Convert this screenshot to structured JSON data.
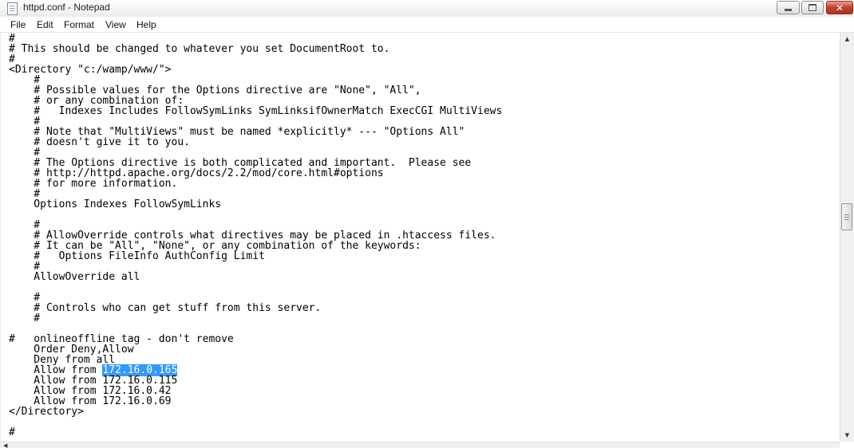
{
  "window": {
    "title": "httpd.conf - Notepad",
    "icon": "notepad-icon",
    "controls": {
      "minimize": "minimize-icon",
      "maximize": "maximize-icon",
      "close": "✕"
    }
  },
  "menu": [
    "File",
    "Edit",
    "Format",
    "View",
    "Help"
  ],
  "editor": {
    "lines": [
      "#",
      "# This should be changed to whatever you set DocumentRoot to.",
      "#",
      "<Directory \"c:/wamp/www/\">",
      "    #",
      "    # Possible values for the Options directive are \"None\", \"All\",",
      "    # or any combination of:",
      "    #   Indexes Includes FollowSymLinks SymLinksifOwnerMatch ExecCGI MultiViews",
      "    #",
      "    # Note that \"MultiViews\" must be named *explicitly* --- \"Options All\"",
      "    # doesn't give it to you.",
      "    #",
      "    # The Options directive is both complicated and important.  Please see",
      "    # http://httpd.apache.org/docs/2.2/mod/core.html#options",
      "    # for more information.",
      "    #",
      "    Options Indexes FollowSymLinks",
      "",
      "    #",
      "    # AllowOverride controls what directives may be placed in .htaccess files.",
      "    # It can be \"All\", \"None\", or any combination of the keywords:",
      "    #   Options FileInfo AuthConfig Limit",
      "    #",
      "    AllowOverride all",
      "",
      "    #",
      "    # Controls who can get stuff from this server.",
      "    #",
      "",
      "#   onlineoffline tag - don't remove",
      "    Order Deny,Allow",
      "    Deny from all",
      "    Allow from ",
      "    Allow from 172.16.0.115",
      "    Allow from 172.16.0.42",
      "    Allow from 172.16.0.69",
      "</Directory>",
      "",
      "#"
    ],
    "selected_line_index": 32,
    "selected_text": "172.16.0.165",
    "selection_color": "#3399ff"
  }
}
